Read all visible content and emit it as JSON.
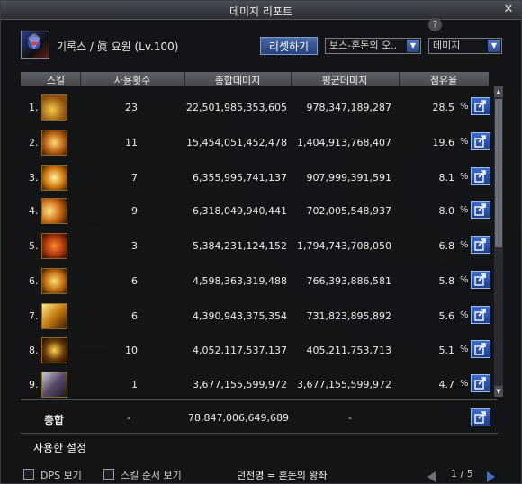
{
  "window": {
    "title": "데미지 리포트"
  },
  "header": {
    "character": "기록스 / 眞 요원 (Lv.100)",
    "reset_label": "리셋하기",
    "dungeon_select": "보스-혼돈의 오..",
    "metric_select": "데미지"
  },
  "columns": [
    "스킬",
    "사용횟수",
    "총합데미지",
    "평균데미지",
    "점유율"
  ],
  "rows": [
    {
      "rank": "1.",
      "count": "23",
      "total": "22,501,985,353,605",
      "avg": "978,347,189,287",
      "pct": "28.5",
      "icon": "skill-icon-1"
    },
    {
      "rank": "2.",
      "count": "11",
      "total": "15,454,051,452,478",
      "avg": "1,404,913,768,407",
      "pct": "19.6",
      "icon": "skill-icon-2"
    },
    {
      "rank": "3.",
      "count": "7",
      "total": "6,355,995,741,137",
      "avg": "907,999,391,591",
      "pct": "8.1",
      "icon": "skill-icon-3"
    },
    {
      "rank": "4.",
      "count": "9",
      "total": "6,318,049,940,441",
      "avg": "702,005,548,937",
      "pct": "8.0",
      "icon": "skill-icon-4"
    },
    {
      "rank": "5.",
      "count": "3",
      "total": "5,384,231,124,152",
      "avg": "1,794,743,708,050",
      "pct": "6.8",
      "icon": "skill-icon-5"
    },
    {
      "rank": "6.",
      "count": "6",
      "total": "4,598,363,319,488",
      "avg": "766,393,886,581",
      "pct": "5.8",
      "icon": "skill-icon-6"
    },
    {
      "rank": "7.",
      "count": "6",
      "total": "4,390,943,375,354",
      "avg": "731,823,895,892",
      "pct": "5.6",
      "icon": "skill-icon-7"
    },
    {
      "rank": "8.",
      "count": "10",
      "total": "4,052,117,537,137",
      "avg": "405,211,753,713",
      "pct": "5.1",
      "icon": "skill-icon-8"
    },
    {
      "rank": "9.",
      "count": "1",
      "total": "3,677,155,599,972",
      "avg": "3,677,155,599,972",
      "pct": "4.7",
      "icon": "skill-icon-9"
    }
  ],
  "total": {
    "label": "총합",
    "count": "-",
    "total": "78,847,006,649,689",
    "avg": "-"
  },
  "percent_sign": "%",
  "tab": {
    "label": "사용한 설정"
  },
  "bottom": {
    "dps_label": "DPS 보기",
    "order_label": "스킬 순서 보기",
    "dungeon": "던전명 = 혼돈의 왕좌",
    "page": "1 / 5"
  },
  "colors": {
    "accent": "#3e6fd0",
    "button": "#2c4a8c"
  }
}
